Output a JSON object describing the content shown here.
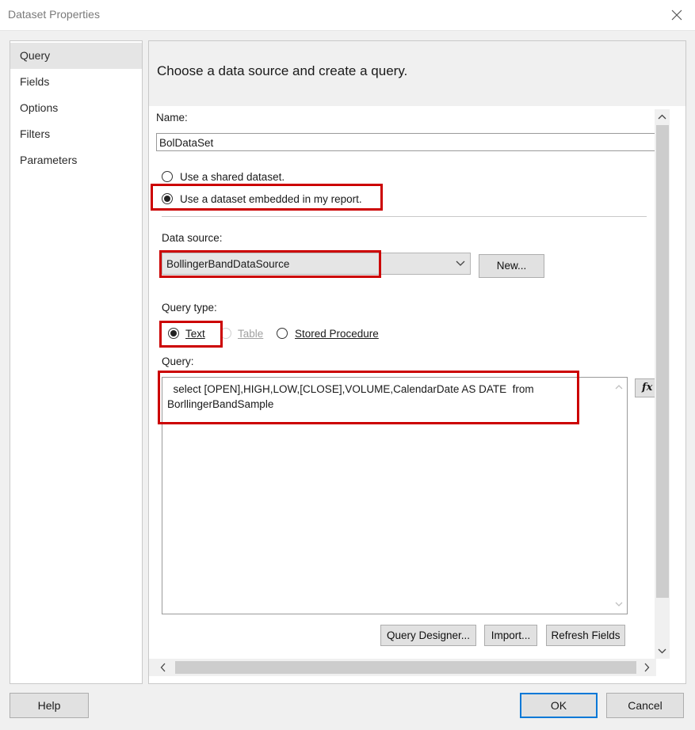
{
  "window": {
    "title": "Dataset Properties"
  },
  "nav": {
    "items": [
      "Query",
      "Fields",
      "Options",
      "Filters",
      "Parameters"
    ],
    "active": "Query"
  },
  "panel": {
    "heading": "Choose a data source and create a query.",
    "name_label": "Name:",
    "name_value": "BolDataSet",
    "radio_shared": "Use a shared dataset.",
    "radio_embedded": "Use a dataset embedded in my report.",
    "data_source_label": "Data source:",
    "data_source_value": "BollingerBandDataSource",
    "new_button": "New...",
    "query_type_label": "Query type:",
    "query_types": [
      "Text",
      "Table",
      "Stored Procedure"
    ],
    "query_label": "Query:",
    "query_text": "  select [OPEN],HIGH,LOW,[CLOSE],VOLUME,CalendarDate AS DATE  from BorllingerBandSample",
    "fx_button": "fx",
    "query_designer_button": "Query Designer...",
    "import_button": "Import...",
    "refresh_fields_button": "Refresh Fields"
  },
  "footer": {
    "help": "Help",
    "ok": "OK",
    "cancel": "Cancel"
  },
  "colors": {
    "highlight": "#cc0000",
    "accent": "#0078d7"
  }
}
